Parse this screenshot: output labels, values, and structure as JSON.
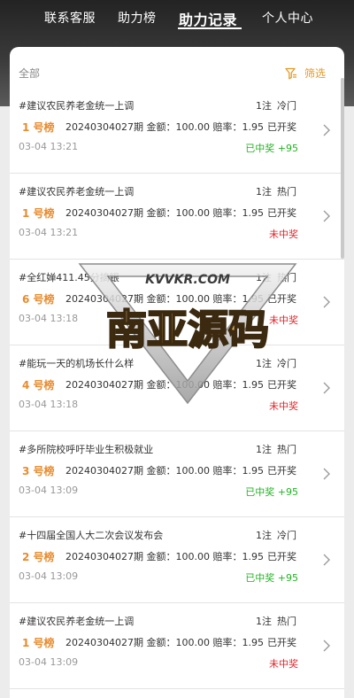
{
  "nav": {
    "items": [
      {
        "label": "联系客服"
      },
      {
        "label": "助力榜"
      },
      {
        "label": "助力记录"
      },
      {
        "label": "个人中心"
      }
    ]
  },
  "header": {
    "all_label": "全部",
    "filter_label": "筛选",
    "filter_icon": "filter-icon"
  },
  "records": [
    {
      "title": "#建议农民养老金统一上调",
      "bets": "1注",
      "heat": "冷门",
      "rank": "1 号榜",
      "meta": "20240304027期  金额：100.00  赔率：1.95",
      "state": "已开奖",
      "time": "03-04 13:21",
      "result": "已中奖 +95",
      "win": true
    },
    {
      "title": "#建议农民养老金统一上调",
      "bets": "1注",
      "heat": "热门",
      "rank": "1 号榜",
      "meta": "20240304027期  金额：100.00  赔率：1.95",
      "state": "已开奖",
      "time": "03-04 13:21",
      "result": "未中奖",
      "win": false
    },
    {
      "title": "#全红婵411.45分摘银",
      "bets": "1注",
      "heat": "热门",
      "rank": "6 号榜",
      "meta": "20240304027期  金额：100.00  赔率：1.95",
      "state": "已开奖",
      "time": "03-04 13:18",
      "result": "未中奖",
      "win": false
    },
    {
      "title": "#能玩一天的机场长什么样",
      "bets": "1注",
      "heat": "冷门",
      "rank": "4 号榜",
      "meta": "20240304027期  金额：100.00  赔率：1.95",
      "state": "已开奖",
      "time": "03-04 13:18",
      "result": "未中奖",
      "win": false
    },
    {
      "title": "#多所院校呼吁毕业生积极就业",
      "bets": "1注",
      "heat": "热门",
      "rank": "3 号榜",
      "meta": "20240304027期  金额：100.00  赔率：1.95",
      "state": "已开奖",
      "time": "03-04 13:09",
      "result": "已中奖 +95",
      "win": true
    },
    {
      "title": "#十四届全国人大二次会议发布会",
      "bets": "1注",
      "heat": "冷门",
      "rank": "2 号榜",
      "meta": "20240304027期  金额：100.00  赔率：1.95",
      "state": "已开奖",
      "time": "03-04 13:09",
      "result": "已中奖 +95",
      "win": true
    },
    {
      "title": "#建议农民养老金统一上调",
      "bets": "1注",
      "heat": "热门",
      "rank": "1 号榜",
      "meta": "20240304027期  金额：100.00  赔率：1.95",
      "state": "已开奖",
      "time": "03-04 13:09",
      "result": "未中奖",
      "win": false
    }
  ],
  "watermark": {
    "top_text": "KVVKR.COM",
    "main_text": "南亚源码"
  },
  "colors": {
    "accent": "#e49a25",
    "win": "#22b322",
    "lose": "#e0262b"
  }
}
